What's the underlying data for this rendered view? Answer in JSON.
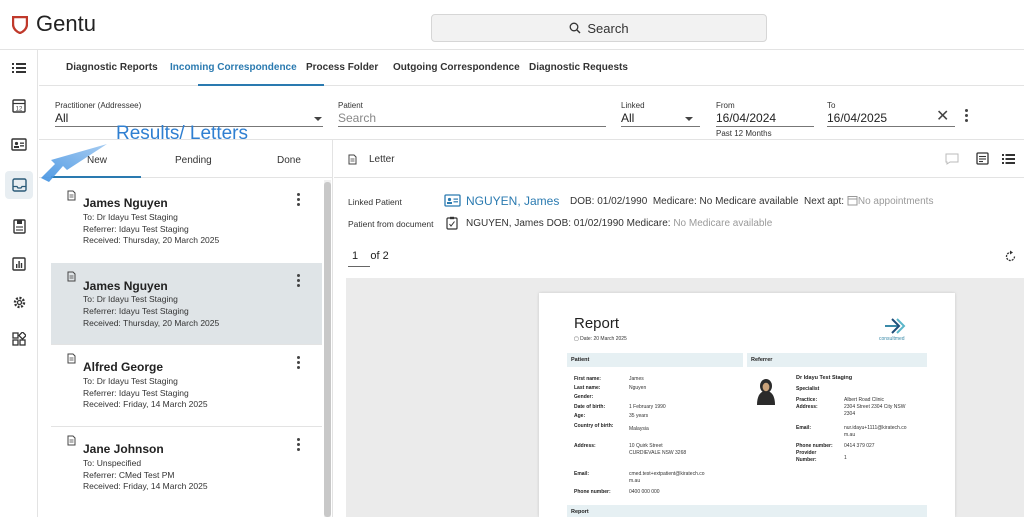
{
  "app": {
    "title": "Gentu"
  },
  "search": {
    "label": "Search"
  },
  "tabs": [
    {
      "label": "Diagnostic Reports"
    },
    {
      "label": "Incoming Correspondence"
    },
    {
      "label": "Process Folder"
    },
    {
      "label": "Outgoing Correspondence"
    },
    {
      "label": "Diagnostic Requests"
    }
  ],
  "filters": {
    "practitioner_label": "Practitioner (Addressee)",
    "practitioner_value": "All",
    "patient_label": "Patient",
    "patient_placeholder": "Search",
    "linked_label": "Linked",
    "linked_value": "All",
    "from_label": "From",
    "from_value": "16/04/2024",
    "from_note": "Past 12 Months",
    "to_label": "To",
    "to_value": "16/04/2025"
  },
  "annotation": "Results/ Letters",
  "subtabs": [
    "New",
    "Pending",
    "Done"
  ],
  "items": [
    {
      "name": "James Nguyen",
      "to": "To: Dr Idayu Test Staging",
      "referrer": "Referrer: Idayu Test Staging",
      "received": "Received:  Thursday, 20 March 2025"
    },
    {
      "name": "James Nguyen",
      "to": "To: Dr Idayu Test Staging",
      "referrer": "Referrer: Idayu Test Staging",
      "received": "Received:  Thursday, 20 March 2025"
    },
    {
      "name": "Alfred George",
      "to": "To: Dr Idayu Test Staging",
      "referrer": "Referrer: Idayu Test Staging",
      "received": "Received:  Friday, 14 March 2025"
    },
    {
      "name": "Jane Johnson",
      "to": "To: Unspecified",
      "referrer": "Referrer: CMed Test PM",
      "received": "Received:  Friday, 14 March 2025"
    }
  ],
  "document": {
    "title": "Letter",
    "linked_patient_label": "Linked Patient",
    "linked_patient_name": "NGUYEN, James",
    "linked_dob": "DOB: 01/02/1990",
    "linked_medicare": "Medicare: No Medicare available",
    "next_apt_label": "Next apt:",
    "next_apt_value": "No appointments",
    "from_doc_label": "Patient from document",
    "from_doc_info": "NGUYEN, James  DOB: 01/02/1990  Medicare: ",
    "from_doc_medicare": "No Medicare available",
    "page_current": "1",
    "page_total": "of 2"
  },
  "report": {
    "title": "Report",
    "date": "Date: 20 March 2025",
    "logo_text": "consultmed",
    "patient_header": "Patient",
    "referrer_header": "Referrer",
    "patient_fields": [
      {
        "k": "First name:",
        "v": "James"
      },
      {
        "k": "Last name:",
        "v": "Nguyen"
      },
      {
        "k": "Gender:",
        "v": ""
      },
      {
        "k": "Date of birth:",
        "v": "1 February 1990"
      },
      {
        "k": "Age:",
        "v": "35 years"
      },
      {
        "k": "Country of birth:",
        "v": "Malaysia"
      },
      {
        "k": "Address:",
        "v": "10 Quirk Street CURDIEVALE NSW 3268"
      },
      {
        "k": "Email:",
        "v": "cmed.test+extpatient@kiratech.com.au"
      },
      {
        "k": "Phone number:",
        "v": "0400 000 000"
      }
    ],
    "referrer_name": "Dr Idayu Test Staging",
    "referrer_role": "Specialist",
    "referrer_fields": [
      {
        "k": "Practice:",
        "v": "Albert Road Clinic"
      },
      {
        "k": "Address:",
        "v": "2304 Street 2304 City NSW 2304"
      },
      {
        "k": "Email:",
        "v": "nur.idayu+1111@kiratech.com.au"
      },
      {
        "k": "Phone number:",
        "v": "0414 379 027"
      },
      {
        "k": "Provider Number:",
        "v": "1"
      }
    ],
    "bottom_header": "Report"
  },
  "colors": {
    "accent": "#2a7ab0",
    "annotation": "#2f7fd1",
    "selected_row": "#dfe4e7",
    "logo_red": "#c0392b"
  }
}
